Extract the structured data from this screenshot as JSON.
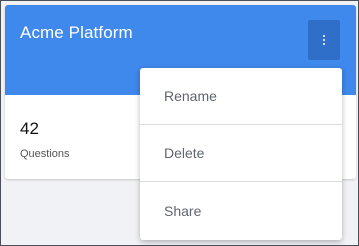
{
  "card": {
    "title": "Acme Platform",
    "stat": {
      "value": "42",
      "label": "Questions"
    },
    "menu_button_icon": "kebab-vertical-icon"
  },
  "dropdown": {
    "items": [
      {
        "label": "Rename"
      },
      {
        "label": "Delete"
      },
      {
        "label": "Share"
      }
    ]
  },
  "colors": {
    "header": "#3f88ec",
    "menu_button": "#2f6fca",
    "menu_text": "#5f6670"
  }
}
